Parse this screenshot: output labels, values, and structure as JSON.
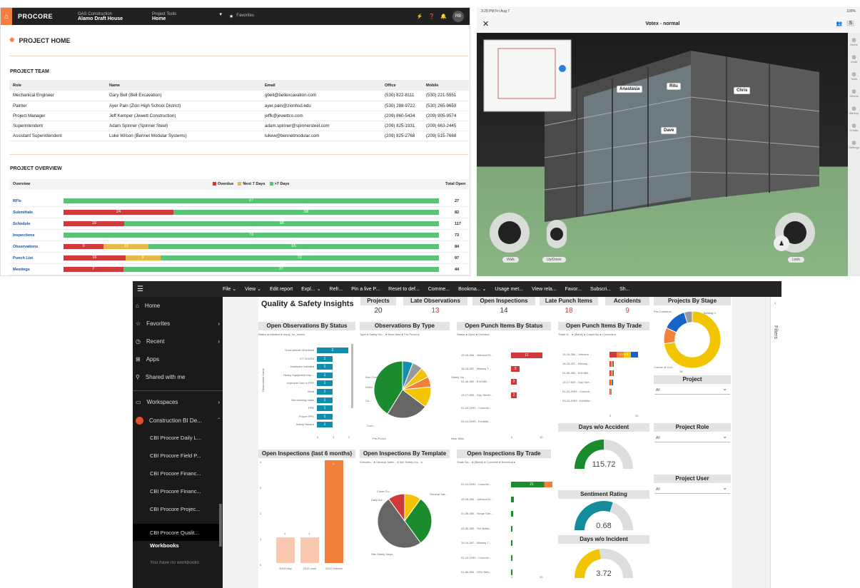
{
  "procore": {
    "brand": "PROCORE",
    "company_label": "GAS Construction",
    "company_value": "Alamo Draft House",
    "tools_label": "Project Tools",
    "tools_value": "Home",
    "favorites": "Favorites",
    "avatar": "RB",
    "page_title": "PROJECT HOME",
    "team_title": "PROJECT TEAM",
    "team_headers": [
      "Role",
      "Name",
      "Email",
      "Office",
      "Mobile"
    ],
    "team_rows": [
      [
        "Mechanical Engineer",
        "Gary Bell (Bell Excavation)",
        "gbell@bellexcavation.com",
        "(530) 822-8111",
        "(530) 221-5551"
      ],
      [
        "Painter",
        "Ayer Pain (Zion High School District)",
        "ayer.pain@zionhsd.edu",
        "(530) 288-9722",
        "(530) 265-9659"
      ],
      [
        "Project Manager",
        "Jeff Kemper (Jewett Construction)",
        "jeffk@jewettco.com",
        "(209) 860-5434",
        "(209) 905-9574"
      ],
      [
        "Superintendent",
        "Adam Spinner (Spinner Steel)",
        "adam.spinner@spinnersteel.com",
        "(209) 825-1931",
        "(209) 663-2445"
      ],
      [
        "Assistant Superintendent",
        "Luke Wilson (Bennet Modular Systems)",
        "lukew@bennetmodular.com",
        "(209) 825-2768",
        "(209) 515-7668"
      ]
    ],
    "overview_title": "PROJECT OVERVIEW",
    "overview_col": "Overview",
    "total_col": "Total Open",
    "legend": [
      "Overdue",
      "Next 7 Days",
      ">7 Days"
    ],
    "overview_colors": [
      "#d0393a",
      "#e8b84a",
      "#5ac27a"
    ],
    "overview_rows": [
      {
        "label": "RFIs",
        "overdue": 0,
        "next7": 0,
        "later": 27,
        "total": "27"
      },
      {
        "label": "Submittals",
        "overdue": 24,
        "next7": 0,
        "later": 58,
        "total": "82"
      },
      {
        "label": "Schedule",
        "overdue": 19,
        "next7": 0,
        "later": 98,
        "total": "117"
      },
      {
        "label": "Inspections",
        "overdue": 0,
        "next7": 0,
        "later": 73,
        "total": "73"
      },
      {
        "label": "Observations",
        "overdue": 9,
        "next7": 10,
        "later": 65,
        "total": "84"
      },
      {
        "label": "Punch List",
        "overdue": 16,
        "next7": 9,
        "later": 72,
        "total": "97"
      },
      {
        "label": "Meetings",
        "overdue": 7,
        "next7": 0,
        "later": 37,
        "total": "44"
      }
    ]
  },
  "votex": {
    "status_left": "3:28 PM  Fri Aug 7",
    "status_right": "100%",
    "title": "Votex - normal",
    "close": "✕",
    "people": [
      "Anastasia",
      "Ritu",
      "Chris",
      "Dave"
    ],
    "side_items": [
      "Home",
      "Undo",
      "Tools",
      "Sheets",
      "Markup",
      "Create",
      "Settings"
    ],
    "controls": [
      "Walk",
      "Up/Down",
      "Look"
    ]
  },
  "pbi": {
    "menu": [
      "File ⌄",
      "View ⌄",
      "Edit report",
      "Expl... ⌄",
      "Refr...",
      "Pin a live P...",
      "Reset to def...",
      "Comme...",
      "Bookma... ⌄",
      "Usage met...",
      "View rela...",
      "Favor...",
      "Subscri...",
      "Sh..."
    ],
    "nav": {
      "home": "Home",
      "favorites": "Favorites",
      "recent": "Recent",
      "apps": "Apps",
      "shared": "Shared with me",
      "workspaces": "Workspaces",
      "ws_name": "Construction BI De...",
      "reports": [
        "CBI Procore Daily L...",
        "CBI Procore Field P...",
        "CBI Procore Financ...",
        "CBI Procore Financ...",
        "CBI Procore Projec...",
        "CBI Procore Qualit..."
      ],
      "workbooks": "Workbooks",
      "no_workbooks": "You have no workbooks"
    },
    "filters": "Filters",
    "title": "Quality & Safety Insights",
    "kpis": [
      {
        "label": "Projects",
        "value": "20",
        "color": "#333"
      },
      {
        "label": "Late Observations",
        "value": "13",
        "color": "#d0393a"
      },
      {
        "label": "Open Inspections",
        "value": "14",
        "color": "#333"
      },
      {
        "label": "Late Punch Items",
        "value": "18",
        "color": "#d0393a"
      },
      {
        "label": "Accidents",
        "value": "9",
        "color": "#d0393a"
      }
    ],
    "visual_titles": {
      "obs_status": "Open Observations By Status",
      "obs_type": "Observations By Type",
      "punch_status": "Open Punch Items By Status",
      "punch_trade": "Open Punch Items By Trade",
      "by_stage": "Projects By Stage",
      "insp_6m": "Open Inspections (last 6 months)",
      "insp_template": "Open Inspections By Template",
      "insp_trade": "Open Inspections By Trade",
      "days_accident": "Days w/o Accident",
      "sentiment": "Sentiment Rating",
      "days_incident": "Days w/o Incident",
      "project": "Project",
      "project_role": "Project Role",
      "project_user": "Project User"
    },
    "obs_status_legend": "Status  ● Initiated  ● ready_for_review",
    "obs_status_axis": "Observation Name",
    "obs_status_items": [
      {
        "label": "Truck almost hit bollard",
        "value": 2
      },
      {
        "label": "GT 101234",
        "value": 1
      },
      {
        "label": "Hardware Installed",
        "value": 1
      },
      {
        "label": "Heavy equipment insp...",
        "value": 1
      },
      {
        "label": "Improper Use of PPE",
        "value": 1
      },
      {
        "label": "Mold",
        "value": 1
      },
      {
        "label": "Not wearing mask",
        "value": 1
      },
      {
        "label": "PPE",
        "value": 1
      },
      {
        "label": "Proper PPE",
        "value": 1
      },
      {
        "label": "Safety Hazard",
        "value": 1
      }
    ],
    "obs_status_ticks": [
      "0",
      "1",
      "2"
    ],
    "obs_type_legend": "Type  ● Safety Vio...  ● Near Miss  ● Pre Punch  ▸",
    "obs_type_labels": [
      "Non-Confo...",
      "Defici...",
      "Co...",
      "Com...",
      "Pre-Punch",
      "Near Miss",
      "Safety Vol..."
    ],
    "obs_type_values": [
      "1",
      "1",
      "1",
      "1",
      "2",
      "4",
      "7"
    ],
    "punch_status_legend": "Status  ● Open  ● Overdue",
    "punch_status_items": [
      {
        "label": "19-16-284 - Johnson N...",
        "value": 11
      },
      {
        "label": "18-16-287 - Midway T...",
        "value": 3
      },
      {
        "label": "04-36-350 - Erin Mill...",
        "value": 2
      },
      {
        "label": "19-17-600 - Gay Street...",
        "value": 2
      },
      {
        "label": "01-24-1999 - Columbi...",
        "value": 0
      },
      {
        "label": "03-24-1999 - Exhibito...",
        "value": 0
      }
    ],
    "punch_status_ticks": [
      "0",
      "10"
    ],
    "punch_trade_legend": "Trade N...  ● (Blank)  ● Carpentry  ● Concrete  ▸",
    "punch_trade_items": [
      {
        "label": "19-16-284 - Johnson ...",
        "value": "2 2 2 2"
      },
      {
        "label": "18-16-287 - Midway ...",
        "value": ""
      },
      {
        "label": "04-36-350 - Erin Mill...",
        "value": ""
      },
      {
        "label": "19-17-600 - Gay Stre...",
        "value": ""
      },
      {
        "label": "01-24-1999 - Columb...",
        "value": ""
      },
      {
        "label": "03-24-1999 - Exhibito...",
        "value": ""
      }
    ],
    "punch_trade_ticks": [
      "0",
      "10"
    ],
    "stage_labels": [
      "Pre-Construct...",
      "Bidding 3",
      "Course of Con...",
      "16"
    ],
    "insp6_items": [
      {
        "label": "2019 May",
        "value": 1
      },
      {
        "label": "2019 June",
        "value": 1
      },
      {
        "label": "2019 October",
        "value": 4
      }
    ],
    "insp6_yticks": [
      "4",
      "3",
      "2",
      "1",
      "0"
    ],
    "insp_tpl_legend": "Checklis...  ● General Safet...  ● Site Safety Ins...  ▸",
    "insp_tpl_labels": [
      "Close Ou...",
      "Daily Ins...",
      "General Saf...",
      "Site Safety Inspe..."
    ],
    "insp_tpl_values": [
      "1",
      "1",
      "3",
      "5"
    ],
    "insp_trade_legend": "Trade Na...  ● (Blank)  ● Concrete  ● Electrical  ▸",
    "insp_trade_items": [
      {
        "label": "01-24-1999 - Columbi...",
        "value": "21"
      },
      {
        "label": "19-16-284 - Johnson N...",
        "value": ""
      },
      {
        "label": "01-36-350 - Yonge Stre...",
        "value": ""
      },
      {
        "label": "03-36-350 - The Baltic...",
        "value": ""
      },
      {
        "label": "19-16-287 - Midway T...",
        "value": ""
      },
      {
        "label": "01-24-1999 - Columbi...",
        "value": ""
      },
      {
        "label": "01-36-350 - OSU Wes...",
        "value": ""
      }
    ],
    "insp_trade_ticks": [
      "0",
      "20"
    ],
    "gauge_accident": "115.72",
    "gauge_sentiment": "0.68",
    "gauge_sentiment_top": "0.59",
    "gauge_incident": "3.72",
    "slicer_value": "All",
    "chart_colors": {
      "teal": "#118dad",
      "red": "#d0393a",
      "green": "#1a8c2e",
      "yellow": "#f2c500",
      "orange": "#f2803a",
      "gray": "#666",
      "blue": "#1664c8"
    }
  }
}
